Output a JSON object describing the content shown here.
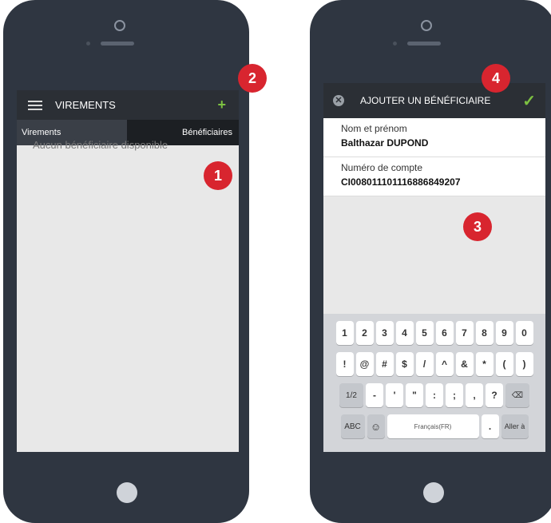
{
  "left_screen": {
    "header_title": "VIREMENTS",
    "plus_label": "+",
    "tabs": [
      {
        "label": "Virements"
      },
      {
        "label": "Bénéficiaires"
      }
    ],
    "empty_message": "Aucun bénéficiaire disponible"
  },
  "right_screen": {
    "header_title": "AJOUTER UN BÉNÉFICIAIRE",
    "close_glyph": "✕",
    "check_glyph": "✓",
    "fields": [
      {
        "label": "Nom et prénom",
        "value": "Balthazar DUPOND"
      },
      {
        "label": "Numéro de compte",
        "value": "CI008011101116886849207"
      }
    ],
    "keyboard": {
      "row1": [
        "1",
        "2",
        "3",
        "4",
        "5",
        "6",
        "7",
        "8",
        "9",
        "0"
      ],
      "row2": [
        "!",
        "@",
        "#",
        "$",
        "/",
        "^",
        "&",
        "*",
        "(",
        ")"
      ],
      "row3": [
        "1/2",
        "-",
        "'",
        "\"",
        ":",
        ";",
        ",",
        "?",
        "⌫"
      ],
      "row4": [
        "ABC",
        "☺",
        "Français(FR)",
        ".",
        "Aller à"
      ]
    }
  },
  "badges": [
    "1",
    "2",
    "3",
    "4"
  ],
  "colors": {
    "accent_green": "#7dc142",
    "badge_red": "#d8252f",
    "phone_body": "#2f3641",
    "app_header": "#2b2f35"
  }
}
